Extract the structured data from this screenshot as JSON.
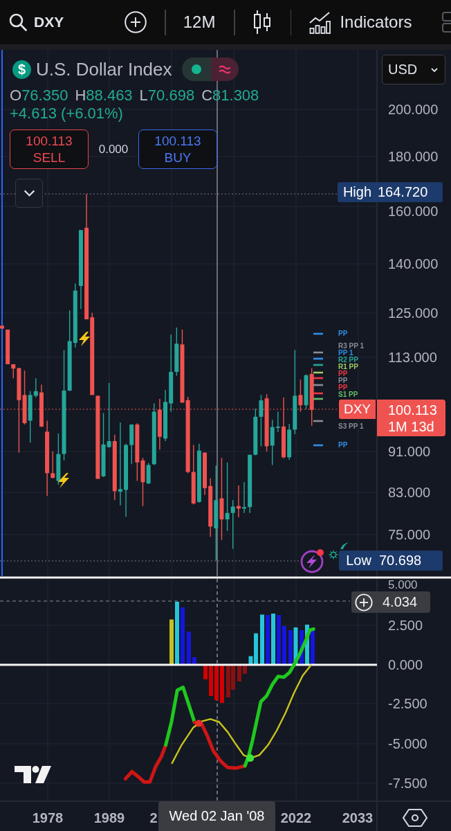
{
  "toolbar": {
    "symbol": "DXY",
    "interval": "12M",
    "indicators": "Indicators"
  },
  "legend": {
    "icon_glyph": "$",
    "title": "U.S. Dollar Index",
    "ohlc": [
      {
        "key": "O",
        "value": "76.350"
      },
      {
        "key": "H",
        "value": "88.463"
      },
      {
        "key": "L",
        "value": "70.698"
      },
      {
        "key": "C",
        "value": "81.308"
      }
    ],
    "change": "+4.613 (+6.01%)"
  },
  "trade": {
    "sell": {
      "price": "100.113",
      "label": "SELL"
    },
    "spread": "0.000",
    "buy": {
      "price": "100.113",
      "label": "BUY"
    }
  },
  "currency_select": {
    "value": "USD"
  },
  "price_axis": {
    "labels": [
      "200.000",
      "180.000",
      "160.000",
      "140.000",
      "125.000",
      "113.000",
      "91.000",
      "83.000",
      "75.000"
    ]
  },
  "high_marker": {
    "label": "High",
    "value": "164.720"
  },
  "pivot_labels": [
    {
      "text": "PP",
      "color": "#2f8fe8"
    },
    {
      "text": "R3 PP 1",
      "color": "#8a8d96"
    },
    {
      "text": "PP 1",
      "color": "#2f8fe8"
    },
    {
      "text": "R2 PP",
      "color": "#26a69a"
    },
    {
      "text": "R1 PP",
      "color": "#9ccc65"
    },
    {
      "text": "PP",
      "color": "#f23645"
    },
    {
      "text": "PP",
      "color": "#8a8d96"
    },
    {
      "text": "PP",
      "color": "#f23645"
    },
    {
      "text": "S1 PP",
      "color": "#66bb6a"
    },
    {
      "text": "S3 PP 1",
      "color": "#8a8d96"
    },
    {
      "text": "PP",
      "color": "#2f8fe8"
    }
  ],
  "last_price": {
    "symbol": "DXY",
    "value": "100.113",
    "countdown": "1M 13d"
  },
  "low_marker": {
    "label": "Low",
    "value": "70.698"
  },
  "oscillator": {
    "axis_labels": [
      "5.000",
      "2.500",
      "0.000",
      "-2.500",
      "-5.000",
      "-7.500"
    ],
    "crosshair_value": "4.034"
  },
  "time_axis": {
    "labels": [
      "1978",
      "1989",
      "2",
      "2022",
      "2033"
    ],
    "crosshair_date": "Wed 02 Jan '08"
  }
}
